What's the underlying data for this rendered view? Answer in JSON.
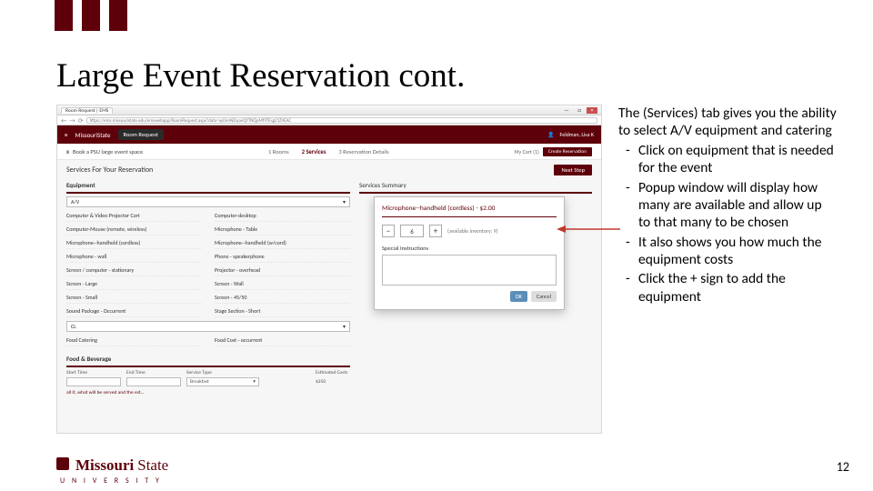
{
  "slide": {
    "title": "Large Event Reservation cont.",
    "page_number": "12"
  },
  "logo": {
    "main": "Missouri",
    "sub": "State",
    "uni": "U N I V E R S I T Y"
  },
  "browser": {
    "tab_title": "Room Request | EMS",
    "url": "https://ems.missouristate.edu/emswebapp/RoomRequest.aspx?data=xy0nnNZsyavQYTNQoMf9TEsg21ZVEAC"
  },
  "app": {
    "brand": "MissouriState",
    "room_request": "Room Request",
    "user": "Feldman, Lisa K",
    "steps": {
      "close_x": "x",
      "label": "Book a PSU large event space",
      "s1": "1 Rooms",
      "s2": "2 Services",
      "s3": "3 Reservation Details",
      "cart": "My Cart (1)",
      "create": "Create Reservation"
    },
    "services_heading": "Services For Your Reservation",
    "next": "Next Step",
    "equipment_section": "Equipment",
    "av_label": "A/V",
    "av_items": [
      [
        "Computer & Video Projector Cart",
        "Computer-desktop"
      ],
      [
        "Computer-Mouse (remote, wireless)",
        "Microphone - Table"
      ],
      [
        "Microphone--handheld (cordless)",
        "Microphone--handheld (w/cord)"
      ],
      [
        "Microphone - wall",
        "Phone - speakerphone"
      ],
      [
        "Screen / computer - stationary",
        "Projector - overhead"
      ],
      [
        "Screen - Large",
        "Screen - Wall"
      ],
      [
        "Screen - Small",
        "Screen - 45/50"
      ],
      [
        "Sound Package - Occurrent",
        "Stage Section - Short"
      ]
    ],
    "cl_label": "CL",
    "food_catering": "Food Catering",
    "food_cost": "Food Cost - occurrent",
    "food_beverage": "Food & Beverage",
    "food_cols": [
      "Start Time",
      "End Time",
      "Service Type",
      "",
      "Estimated Costs"
    ],
    "food_service": "Breakfast",
    "food_cost_val": "$250",
    "note": "all it, what will be served and the est…",
    "summary": "Services Summary"
  },
  "popup": {
    "title": "Microphone--handheld (cordless) - $2.00",
    "minus": "−",
    "plus": "+",
    "qty": "6",
    "avail": "(available inventory: 9)",
    "special": "Special Instructions",
    "ok": "OK",
    "cancel": "Cancel"
  },
  "explain": {
    "lead_a": "The (Services) tab ",
    "lead_b": "gives you the ability to select A/V equipment and catering",
    "b1": "Click on equipment that is needed for the event",
    "b2": "Popup window will display how many are available and allow up to that many to be chosen",
    "b3": "It also shows you how much the equipment costs",
    "b4": "Click the + sign to add the equipment"
  }
}
